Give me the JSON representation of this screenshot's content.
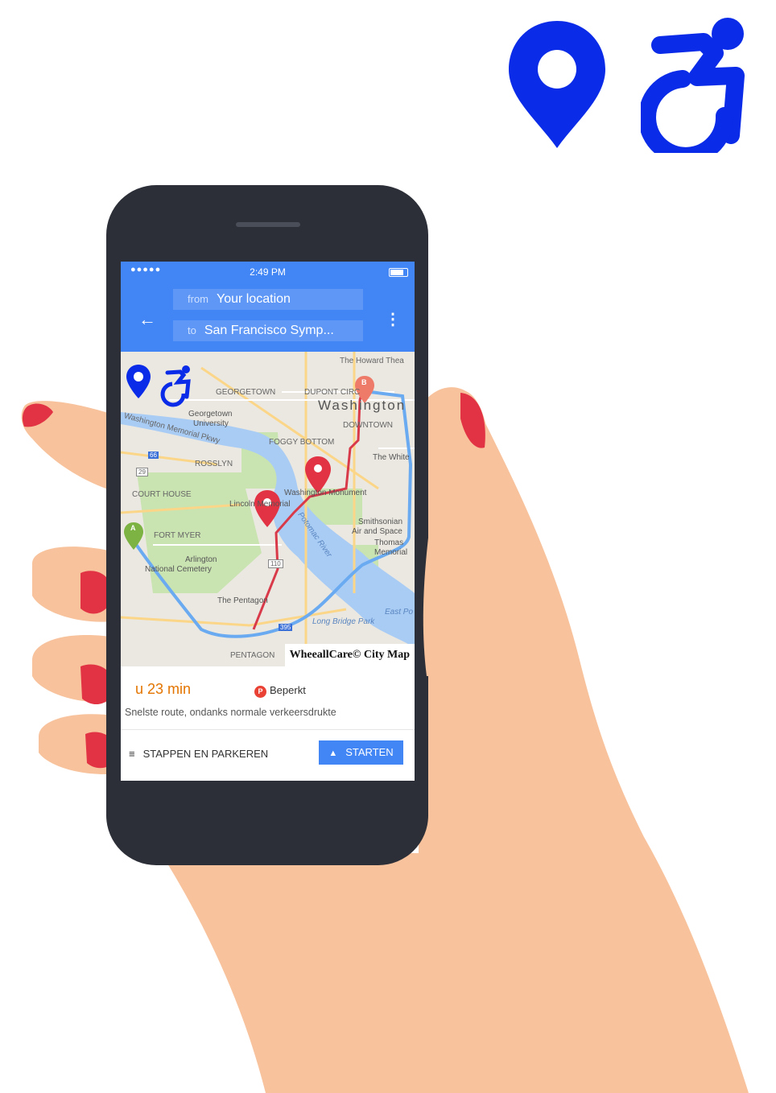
{
  "status_bar": {
    "signal": "●●●●●",
    "time": "2:49 PM"
  },
  "directions": {
    "from_prefix": "from",
    "from_value": "Your location",
    "to_prefix": "to",
    "to_value": "San Francisco Symp..."
  },
  "map": {
    "labels": {
      "howard": "The Howard Thea",
      "georgetown": "GEORGETOWN",
      "georgetown_univ_1": "Georgetown",
      "georgetown_univ_2": "University",
      "dupont": "DUPONT CIRC",
      "washington": "Washington",
      "downtown": "DOWNTOWN",
      "memorial_pkwy": "Washington Memorial Pkwy",
      "foggy_bottom": "FOGGY BOTTOM",
      "rosslyn": "ROSSLYN",
      "white": "The White",
      "courthouse": "COURT HOUSE",
      "monument": "Washington Monument",
      "lincoln": "Lincoln Memorial",
      "smithsonian_1": "Smithsonian",
      "smithsonian_2": "Air and Space",
      "fort_myer": "FORT MYER",
      "thomas_1": "Thomas",
      "thomas_2": "Memorial",
      "potomac": "Potomac River",
      "arlington_1": "Arlington",
      "arlington_2": "National Cemetery",
      "pentagon": "The Pentagon",
      "east": "East Po",
      "bridge_park": "Long Bridge Park",
      "pentagon_city": "PENTAGON",
      "shield_66": "66",
      "shield_29": "29",
      "shield_110": "110",
      "shield_395": "395",
      "marker_a": "A",
      "marker_b": "B"
    },
    "brand": "WheeallCare© City Map"
  },
  "route_card": {
    "duration": "u 23 min",
    "parking_badge": "P",
    "parking": "Beperkt",
    "description": "Snelste route, ondanks normale verkeersdrukte",
    "steps_icon": "≡",
    "steps": "STAPPEN EN PARKEREN",
    "start_icon": "▲",
    "start": "STARTEN"
  },
  "icons": [
    "location-pin-icon",
    "wheelchair-icon"
  ],
  "colors": {
    "brand_blue": "#0a2be8",
    "maps_blue": "#4285f4",
    "route_red": "#d93a4a",
    "route_blue": "#6aaaf0",
    "skin": "#f7c29c",
    "nail": "#e23344"
  }
}
